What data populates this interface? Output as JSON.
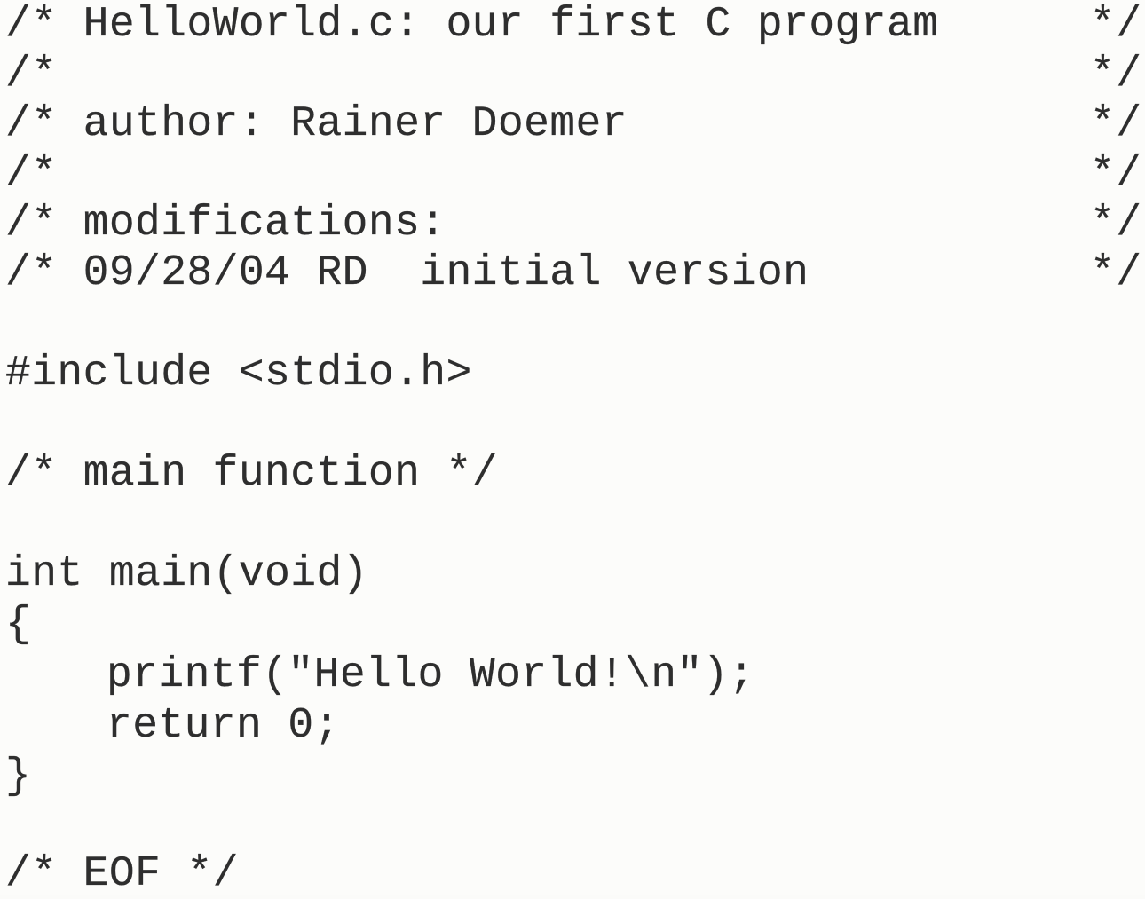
{
  "header_comment": [
    {
      "text": "/* HelloWorld.c: our first C program",
      "end": "*/"
    },
    {
      "text": "/*",
      "end": "*/"
    },
    {
      "text": "/* author: Rainer Doemer",
      "end": "*/"
    },
    {
      "text": "/*",
      "end": "*/"
    },
    {
      "text": "/* modifications:",
      "end": "*/"
    },
    {
      "text": "/* 09/28/04 RD  initial version",
      "end": "*/"
    }
  ],
  "include_line": "#include <stdio.h>",
  "main_comment": "/* main function */",
  "main_signature": "int main(void)",
  "open_brace": "{",
  "body_lines": [
    "printf(\"Hello World!\\n\");",
    "return 0;"
  ],
  "close_brace": "}",
  "eof_comment": "/* EOF */"
}
